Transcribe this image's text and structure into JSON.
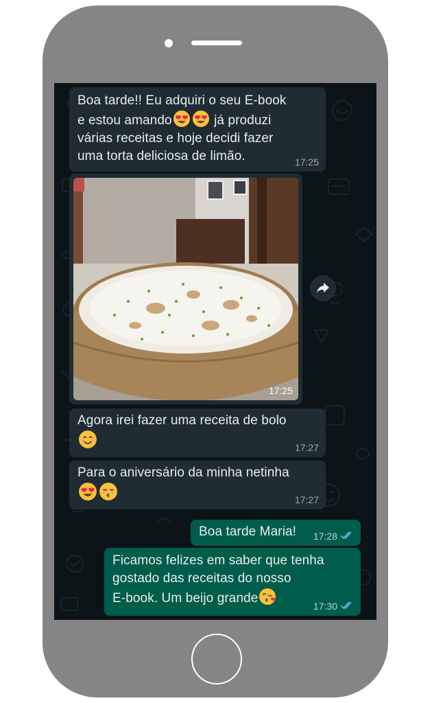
{
  "chat": {
    "messages": [
      {
        "direction": "incoming",
        "lines": [
          "Boa tarde!! Eu adquiri o seu E-book",
          "e estou amando",
          "já produzi",
          "várias receitas e hoje decidi fazer",
          "uma torta deliciosa de limão."
        ],
        "emojis": [
          "heart-eyes",
          "heart-eyes"
        ],
        "time": "17:25"
      },
      {
        "direction": "incoming",
        "type": "image",
        "image_subject": "torta de limão",
        "time": "17:25"
      },
      {
        "direction": "incoming",
        "lines": [
          "Agora irei fazer uma receita de bolo"
        ],
        "emojis": [
          "smiling-face"
        ],
        "time": "17:27"
      },
      {
        "direction": "incoming",
        "lines": [
          "Para o aniversário da minha netinha"
        ],
        "emojis": [
          "heart-eyes",
          "kissing-closed-eyes"
        ],
        "time": "17:27"
      },
      {
        "direction": "outgoing",
        "lines": [
          "Boa tarde Maria!"
        ],
        "time": "17:28",
        "status": "read"
      },
      {
        "direction": "outgoing",
        "lines": [
          "Ficamos felizes em saber que tenha",
          "gostado das receitas do nosso",
          "E-book. Um beijo grande"
        ],
        "emojis": [
          "blowing-kiss"
        ],
        "time": "17:30",
        "status": "read"
      }
    ]
  },
  "colors": {
    "phone_body": "#858585",
    "chat_background": "#0d1418",
    "incoming_bubble": "#1f2c33",
    "outgoing_bubble": "#005c4b",
    "read_ticks": "#53bdeb"
  },
  "icons": [
    "forward-icon",
    "double-check-icon",
    "home-button"
  ]
}
